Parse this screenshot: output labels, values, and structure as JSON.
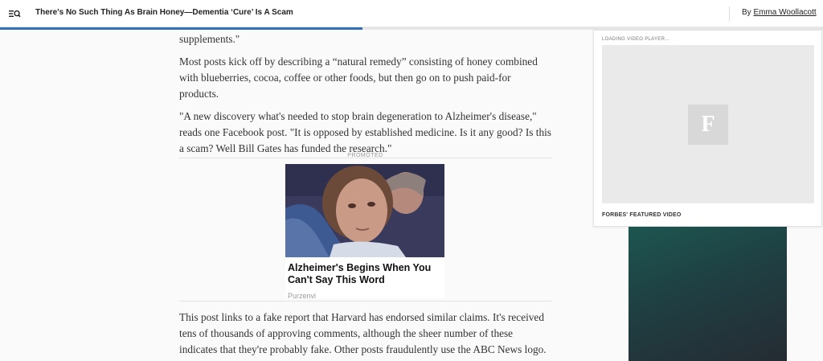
{
  "header": {
    "headline": "There's No Such Thing As Brain Honey—Dementia ‘Cure’ Is A Scam",
    "byline_prefix": "By",
    "author": "Emma Woollacott",
    "menu_icon": "menu-search-icon",
    "read_progress": 0.44
  },
  "article": {
    "fragment": "supplements.\"",
    "paragraphs": [
      "Most posts kick off by describing a “natural remedy” consisting of honey combined with blueberries, cocoa, coffee or other foods, but then go on to push paid-for products.",
      "\"A new discovery what's needed to stop brain degeneration to Alzheimer's disease,\" reads one Facebook post. \"It is opposed by established medicine. Is it any good? Is this a scam? Well Bill Gates has funded the research.\"",
      "This post links to a fake report that Harvard has endorsed similar claims. It's received tens of thousands of approving comments, although the sheer number of these indicates that they're probably fake. Other posts fraudulently use the ABC News logo."
    ]
  },
  "promo": {
    "label": "PROMOTED",
    "title": "Alzheimer's Begins When You Can't Say This Word",
    "source": "Purzenvi"
  },
  "video": {
    "loading_label": "LOADING VIDEO PLAYER...",
    "logo_letter": "F",
    "featured_label": "FORBES' FEATURED VIDEO"
  },
  "colors": {
    "progress": "#3271b8",
    "side_ad_top": "#1d5650",
    "side_ad_bottom": "#252b33"
  }
}
